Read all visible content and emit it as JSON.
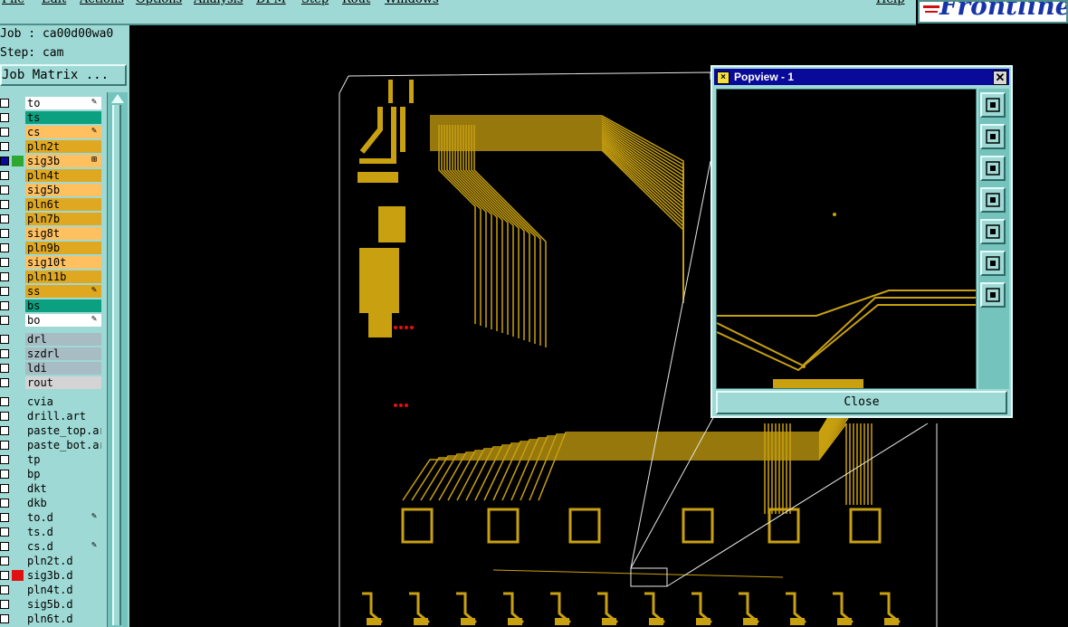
{
  "menubar": {
    "items": [
      "File",
      "Edit",
      "Actions",
      "Options",
      "Analysis",
      "DFM",
      "Step",
      "Rout",
      "Windows",
      "Help"
    ]
  },
  "logo": {
    "text": "Frontline"
  },
  "job": {
    "job_line": "Job : ca00d00wa0",
    "step_line": "Step: cam"
  },
  "job_matrix_label": "Job Matrix ...",
  "layers": [
    {
      "name": "to",
      "color": "#ffffff",
      "marker": "pen"
    },
    {
      "name": "ts",
      "color": "#0aa080",
      "marker": ""
    },
    {
      "name": "cs",
      "color": "#ffc060",
      "marker": "pen"
    },
    {
      "name": "pln2t",
      "color": "#e0a820",
      "marker": ""
    },
    {
      "name": "sig3b",
      "color": "#ffc060",
      "marker": "grid",
      "active": true
    },
    {
      "name": "pln4t",
      "color": "#e0a820",
      "marker": ""
    },
    {
      "name": "sig5b",
      "color": "#ffc060",
      "marker": ""
    },
    {
      "name": "pln6t",
      "color": "#e0a820",
      "marker": ""
    },
    {
      "name": "pln7b",
      "color": "#e0a820",
      "marker": ""
    },
    {
      "name": "sig8t",
      "color": "#ffc060",
      "marker": ""
    },
    {
      "name": "pln9b",
      "color": "#e0a820",
      "marker": ""
    },
    {
      "name": "sig10t",
      "color": "#ffc060",
      "marker": ""
    },
    {
      "name": "pln11b",
      "color": "#e0a820",
      "marker": ""
    },
    {
      "name": "ss",
      "color": "#e0a820",
      "marker": "pen"
    },
    {
      "name": "bs",
      "color": "#0aa080",
      "marker": ""
    },
    {
      "name": "bo",
      "color": "#ffffff",
      "marker": "pen"
    },
    {
      "name": "drl",
      "color": "#a8bcc4",
      "marker": "",
      "gap": true
    },
    {
      "name": "szdrl",
      "color": "#a8bcc4",
      "marker": ""
    },
    {
      "name": "ldi",
      "color": "#a8bcc4",
      "marker": ""
    },
    {
      "name": "rout",
      "color": "#d4d4d4",
      "marker": ""
    },
    {
      "name": "cvia",
      "color": "#9ed9d5",
      "marker": "",
      "gap": true
    },
    {
      "name": "drill.art",
      "color": "#9ed9d5",
      "marker": ""
    },
    {
      "name": "paste_top.ar",
      "color": "#9ed9d5",
      "marker": ""
    },
    {
      "name": "paste_bot.ar",
      "color": "#9ed9d5",
      "marker": ""
    },
    {
      "name": "tp",
      "color": "#9ed9d5",
      "marker": ""
    },
    {
      "name": "bp",
      "color": "#9ed9d5",
      "marker": ""
    },
    {
      "name": "dkt",
      "color": "#9ed9d5",
      "marker": ""
    },
    {
      "name": "dkb",
      "color": "#9ed9d5",
      "marker": ""
    },
    {
      "name": "to.d",
      "color": "#9ed9d5",
      "marker": "pen"
    },
    {
      "name": "ts.d",
      "color": "#9ed9d5",
      "marker": ""
    },
    {
      "name": "cs.d",
      "color": "#9ed9d5",
      "marker": "pen"
    },
    {
      "name": "pln2t.d",
      "color": "#9ed9d5",
      "marker": ""
    },
    {
      "name": "sig3b.d",
      "color": "#9ed9d5",
      "marker": "",
      "swatch": "#e21010"
    },
    {
      "name": "pln4t.d",
      "color": "#9ed9d5",
      "marker": ""
    },
    {
      "name": "sig5b.d",
      "color": "#9ed9d5",
      "marker": ""
    },
    {
      "name": "pln6t.d",
      "color": "#9ed9d5",
      "marker": ""
    }
  ],
  "colors": {
    "trace": "#c8a010",
    "panel": "#9ed9d5",
    "active_swatch": "#2ea82e",
    "title_bar": "#0a0a9a"
  },
  "popview": {
    "title": "Popview - 1",
    "close_label": "Close",
    "tools": [
      "zoom-fit-icon",
      "pan-up-icon",
      "pan-down-icon",
      "pan-left-icon",
      "pan-right-icon",
      "zoom-in-icon",
      "zoom-out-icon"
    ]
  }
}
